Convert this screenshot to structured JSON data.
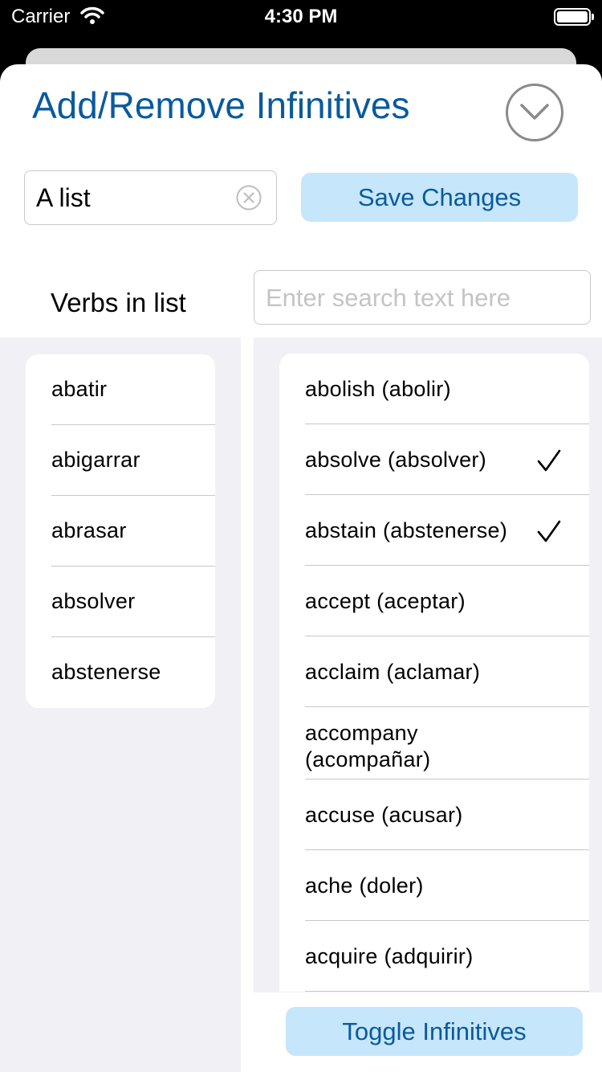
{
  "status_bar": {
    "carrier": "Carrier",
    "time": "4:30 PM"
  },
  "sheet": {
    "title": "Add/Remove Infinitives",
    "list_name_value": "A list",
    "save_label": "Save Changes",
    "verbs_label": "Verbs in list",
    "search_placeholder": "Enter search text here",
    "toggle_label": "Toggle Infinitives"
  },
  "verbs_in_list": [
    "abatir",
    "abigarrar",
    "abrasar",
    "absolver",
    "abstenerse"
  ],
  "infinitives": [
    {
      "label": "abolish (abolir)",
      "checked": false
    },
    {
      "label": "absolve (absolver)",
      "checked": true
    },
    {
      "label": "abstain (abstenerse)",
      "checked": true
    },
    {
      "label": "accept (aceptar)",
      "checked": false
    },
    {
      "label": "acclaim (aclamar)",
      "checked": false
    },
    {
      "label": "accompany (acompañar)",
      "checked": false
    },
    {
      "label": "accuse (acusar)",
      "checked": false
    },
    {
      "label": "ache (doler)",
      "checked": false
    },
    {
      "label": "acquire (adquirir)",
      "checked": false
    }
  ],
  "colors": {
    "accent": "#0a5a9c",
    "button_bg": "#c6e6fb",
    "panel_bg": "#f1f1f5"
  }
}
